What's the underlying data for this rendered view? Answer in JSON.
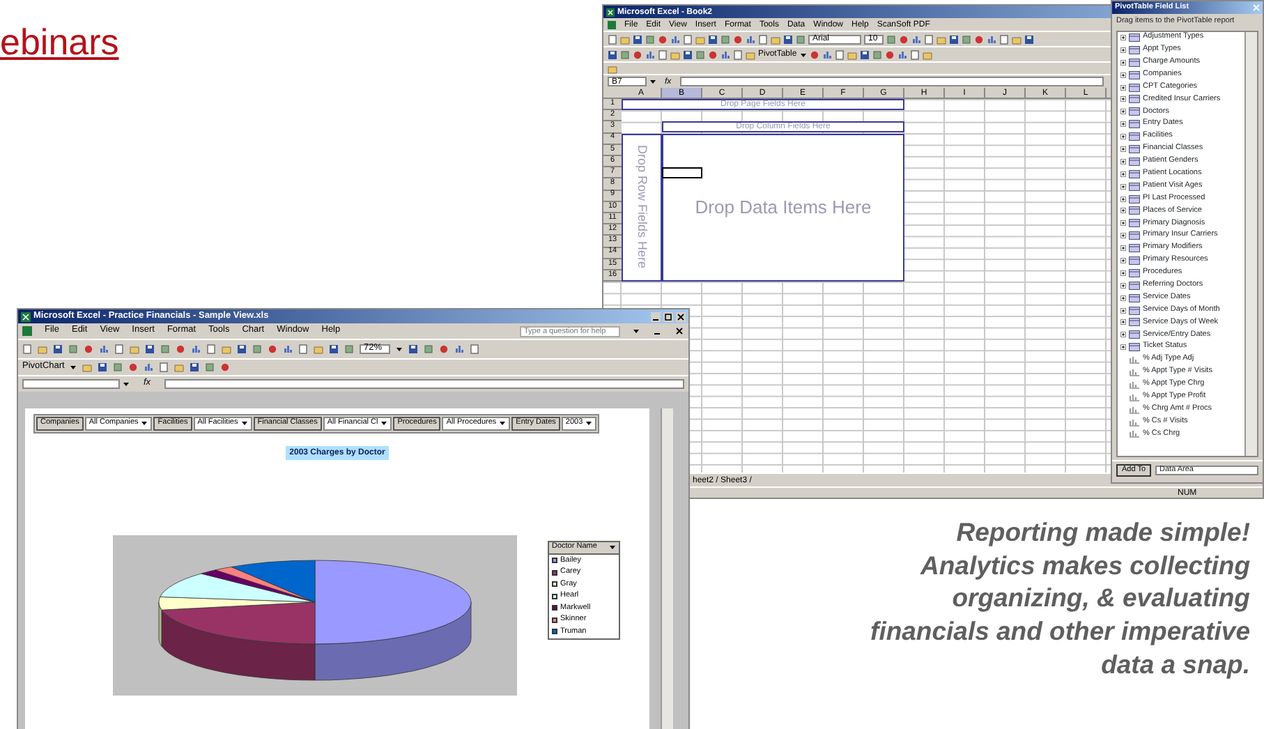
{
  "slide_heading": "ebinars",
  "book_window": {
    "title": "Microsoft Excel - Book2",
    "menu": [
      "File",
      "Edit",
      "View",
      "Insert",
      "Format",
      "Tools",
      "Data",
      "Window",
      "Help",
      "ScanSoft PDF"
    ],
    "font_name": "Arial",
    "font_size": "10",
    "pivot_button": "PivotTable",
    "name_box": "B7",
    "formula_symbol": "fx",
    "columns": [
      {
        "label": "A",
        "selected": false
      },
      {
        "label": "B",
        "selected": true
      },
      {
        "label": "C",
        "selected": false
      },
      {
        "label": "D",
        "selected": false
      },
      {
        "label": "E",
        "selected": false
      },
      {
        "label": "F",
        "selected": false
      },
      {
        "label": "G",
        "selected": false
      },
      {
        "label": "H",
        "selected": false
      },
      {
        "label": "I",
        "selected": false
      },
      {
        "label": "J",
        "selected": false
      },
      {
        "label": "K",
        "selected": false
      },
      {
        "label": "L",
        "selected": false
      }
    ],
    "rows": [
      "1",
      "2",
      "3",
      "4",
      "5",
      "6",
      "7",
      "8",
      "9",
      "10",
      "11",
      "12",
      "13",
      "14",
      "15",
      "16"
    ],
    "drop_page": "Drop Page Fields Here",
    "drop_column": "Drop Column Fields Here",
    "drop_row": "Drop Row Fields Here",
    "drop_data": "Drop Data Items Here",
    "sheet_tabs": "heet2 / Sheet3 /",
    "status": "NUM"
  },
  "field_list": {
    "title": "PivotTable Field List",
    "hint": "Drag items to the PivotTable report",
    "fields": [
      {
        "label": "Adjustment Types",
        "kind": "dimension"
      },
      {
        "label": "Appt Types",
        "kind": "dimension"
      },
      {
        "label": "Charge Amounts",
        "kind": "dimension"
      },
      {
        "label": "Companies",
        "kind": "dimension"
      },
      {
        "label": "CPT Categories",
        "kind": "dimension"
      },
      {
        "label": "Credited Insur Carriers",
        "kind": "dimension"
      },
      {
        "label": "Doctors",
        "kind": "dimension"
      },
      {
        "label": "Entry Dates",
        "kind": "dimension"
      },
      {
        "label": "Facilities",
        "kind": "dimension"
      },
      {
        "label": "Financial Classes",
        "kind": "dimension"
      },
      {
        "label": "Patient Genders",
        "kind": "dimension"
      },
      {
        "label": "Patient Locations",
        "kind": "dimension"
      },
      {
        "label": "Patient Visit Ages",
        "kind": "dimension"
      },
      {
        "label": "PI Last Processed",
        "kind": "dimension"
      },
      {
        "label": "Places of Service",
        "kind": "dimension"
      },
      {
        "label": "Primary Diagnosis",
        "kind": "dimension"
      },
      {
        "label": "Primary Insur Carriers",
        "kind": "dimension"
      },
      {
        "label": "Primary Modifiers",
        "kind": "dimension"
      },
      {
        "label": "Primary Resources",
        "kind": "dimension"
      },
      {
        "label": "Procedures",
        "kind": "dimension"
      },
      {
        "label": "Referring Doctors",
        "kind": "dimension"
      },
      {
        "label": "Service Dates",
        "kind": "dimension"
      },
      {
        "label": "Service Days of Month",
        "kind": "dimension"
      },
      {
        "label": "Service Days of Week",
        "kind": "dimension"
      },
      {
        "label": "Service/Entry Dates",
        "kind": "dimension"
      },
      {
        "label": "Ticket Status",
        "kind": "dimension"
      },
      {
        "label": "% Adj Type Adj",
        "kind": "measure"
      },
      {
        "label": "% Appt Type # Visits",
        "kind": "measure"
      },
      {
        "label": "% Appt Type Chrg",
        "kind": "measure"
      },
      {
        "label": "% Appt Type Profit",
        "kind": "measure"
      },
      {
        "label": "% Chrg Amt # Procs",
        "kind": "measure"
      },
      {
        "label": "% Cs # Visits",
        "kind": "measure"
      },
      {
        "label": "% Cs Chrg",
        "kind": "measure"
      }
    ],
    "add_button": "Add To",
    "area": "Data Area"
  },
  "chart_window": {
    "title": "Microsoft Excel - Practice Financials - Sample View.xls",
    "menu": [
      "File",
      "Edit",
      "View",
      "Insert",
      "Format",
      "Tools",
      "Chart",
      "Window",
      "Help"
    ],
    "help_placeholder": "Type a question for help",
    "zoom": "72%",
    "pivot_button": "PivotChart",
    "formula_symbol": "fx",
    "page_fields": [
      {
        "label": "Companies",
        "value": "All Companies"
      },
      {
        "label": "Facilities",
        "value": "All Facilities"
      },
      {
        "label": "Financial Classes",
        "value": "All Financial Cl"
      },
      {
        "label": "Procedures",
        "value": "All Procedures"
      },
      {
        "label": "Entry Dates",
        "value": "2003"
      }
    ],
    "chart_title": "2003 Charges by Doctor",
    "legend": {
      "title": "Doctor Name",
      "items": [
        {
          "label": "Bailey",
          "color": "#9999ff"
        },
        {
          "label": "Carey",
          "color": "#993366"
        },
        {
          "label": "Gray",
          "color": "#ffffcc"
        },
        {
          "label": "Hearl",
          "color": "#ccffff"
        },
        {
          "label": "Markwell",
          "color": "#660066"
        },
        {
          "label": "Skinner",
          "color": "#ff8080"
        },
        {
          "label": "Truman",
          "color": "#0066cc"
        }
      ]
    }
  },
  "caption_lines": [
    "Reporting made simple!",
    "Analytics makes collecting",
    "organizing, & evaluating",
    "financials and other imperative",
    "data a snap."
  ]
}
